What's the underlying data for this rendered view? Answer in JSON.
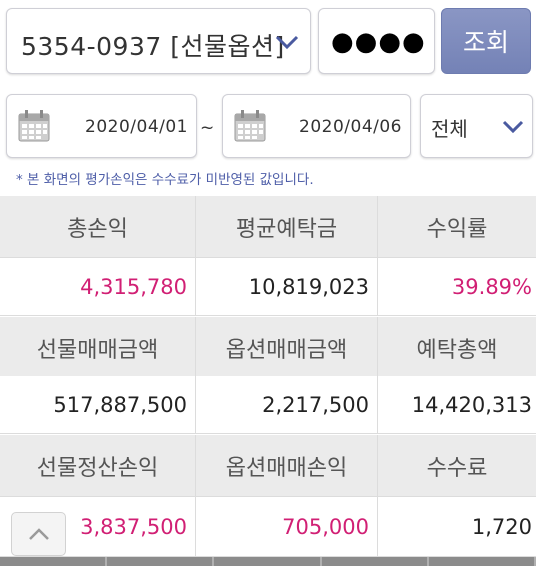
{
  "account": {
    "value": "5354-0937 [선물옵션]",
    "chevron_icon": "chevron-down-icon"
  },
  "password": {
    "masked": "●●●●"
  },
  "search_button": {
    "label": "조회"
  },
  "date_range": {
    "from": "2020/04/01",
    "separator": "~",
    "to": "2020/04/06",
    "calendar_icon": "calendar-icon"
  },
  "filter": {
    "selected": "전체"
  },
  "notice": "* 본 화면의 평가손익은 수수료가 미반영된 값입니다.",
  "summary": {
    "row1": {
      "h1": "총손익",
      "h2": "평균예탁금",
      "h3": "수익률",
      "v1": "4,315,780",
      "v2": "10,819,023",
      "v3": "39.89%"
    },
    "row2": {
      "h1": "선물매매금액",
      "h2": "옵션매매금액",
      "h3": "예탁총액",
      "v1": "517,887,500",
      "v2": "2,217,500",
      "v3": "14,420,313"
    },
    "row3": {
      "h1": "선물정산손익",
      "h2": "옵션매매손익",
      "h3": "수수료",
      "v1": "3,837,500",
      "v2": "705,000",
      "v3": "1,720"
    }
  },
  "colors": {
    "accent_button": "#7d89bb",
    "positive_value": "#d11f74",
    "notice_text": "#4e5ea8",
    "header_bg": "#ebebeb"
  }
}
